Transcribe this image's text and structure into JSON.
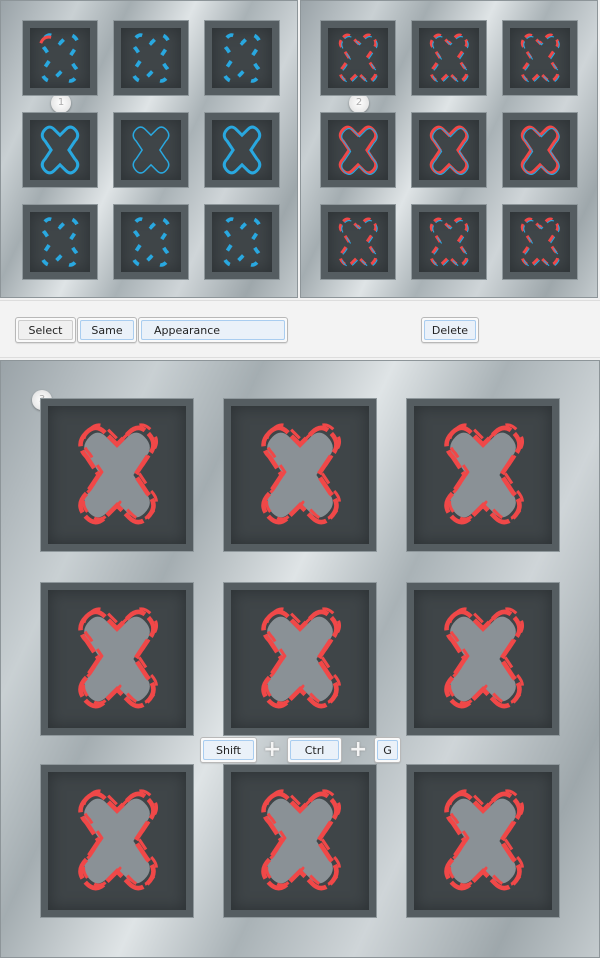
{
  "steps": {
    "one": "1",
    "two": "2",
    "three": "3"
  },
  "toolbar": {
    "select": "Select",
    "same": "Same",
    "appearance": "Appearance",
    "delete": "Delete"
  },
  "shortcut": {
    "shift": "Shift",
    "ctrl": "Ctrl",
    "g": "G",
    "plus": "+"
  },
  "colors": {
    "blue": "#29a8e0",
    "red": "#f04848",
    "fill": "#8a9196",
    "tile": "#3f4548"
  },
  "icons": [
    "x-shape-icon"
  ]
}
